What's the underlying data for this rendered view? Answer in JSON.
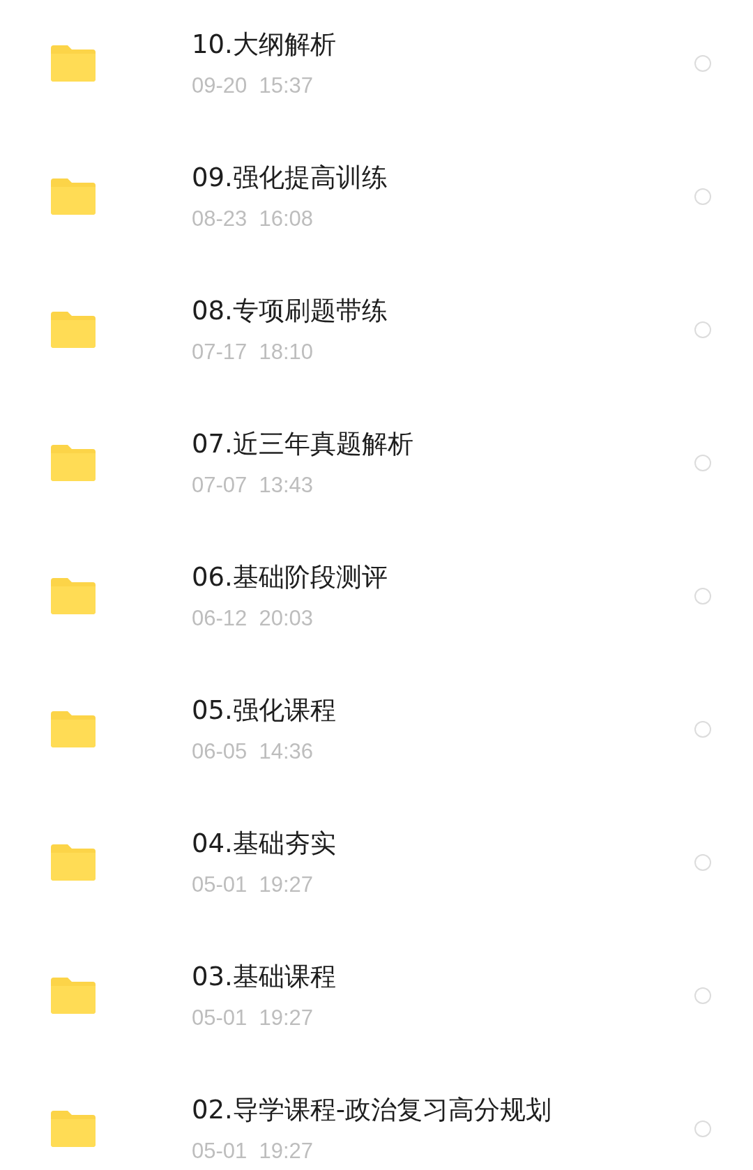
{
  "files": [
    {
      "name": "10.大纲解析",
      "date": "09-20  15:37",
      "selected": false
    },
    {
      "name": "09.强化提高训练",
      "date": "08-23  16:08",
      "selected": false
    },
    {
      "name": "08.专项刷题带练",
      "date": "07-17  18:10",
      "selected": false
    },
    {
      "name": "07.近三年真题解析",
      "date": "07-07  13:43",
      "selected": false
    },
    {
      "name": "06.基础阶段测评",
      "date": "06-12  20:03",
      "selected": false
    },
    {
      "name": "05.强化课程",
      "date": "06-05  14:36",
      "selected": false
    },
    {
      "name": "04.基础夯实",
      "date": "05-01  19:27",
      "selected": false
    },
    {
      "name": "03.基础课程",
      "date": "05-01  19:27",
      "selected": false
    },
    {
      "name": "02.导学课程-政治复习高分规划",
      "date": "05-01  19:27",
      "selected": false
    }
  ]
}
